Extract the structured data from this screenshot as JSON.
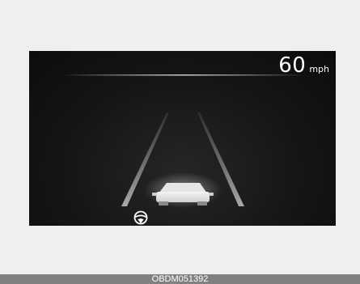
{
  "cluster": {
    "speed_value": "60",
    "speed_unit": "mph",
    "icons": [
      "steering-wheel-icon",
      "lead-vehicle-icon"
    ],
    "colors": {
      "background": "#141414",
      "text": "#ffffff",
      "lanes": "#9a9a9a"
    }
  },
  "caption": {
    "code": "OBDM051392"
  }
}
